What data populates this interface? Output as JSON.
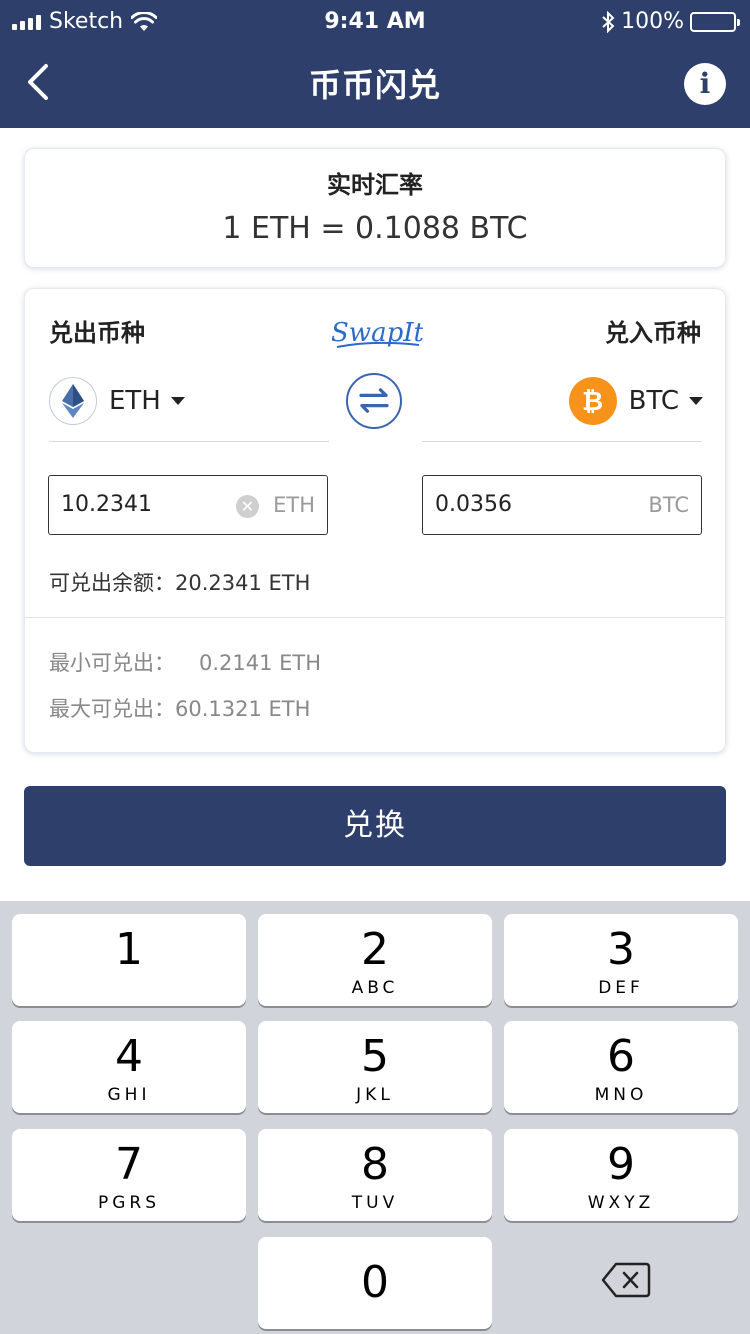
{
  "status_bar": {
    "carrier": "Sketch",
    "time": "9:41 AM",
    "battery": "100%"
  },
  "nav": {
    "title": "币币闪兑",
    "back_icon": "chevron-left-icon",
    "info_icon": "info-icon",
    "info_glyph": "i"
  },
  "rate": {
    "title": "实时汇率",
    "value": "1 ETH = 0.1088 BTC"
  },
  "swap": {
    "out_label": "兑出币种",
    "in_label": "兑入币种",
    "brand": "SwapIt",
    "from_coin": "ETH",
    "to_coin": "BTC",
    "to_coin_glyph": "₿",
    "from_amount": "10.2341",
    "from_unit": "ETH",
    "to_amount": "0.0356",
    "to_unit": "BTC",
    "clear_glyph": "✕",
    "balance": "可兑出余额：20.2341 ETH",
    "min_label": "最小可兑出：",
    "min_value": "0.2141 ETH",
    "max_label": "最大可兑出：",
    "max_value": "60.1321 ETH"
  },
  "exchange_button": "兑换",
  "keypad": {
    "keys": [
      {
        "num": "1",
        "letters": ""
      },
      {
        "num": "2",
        "letters": "ABC"
      },
      {
        "num": "3",
        "letters": "DEF"
      },
      {
        "num": "4",
        "letters": "GHI"
      },
      {
        "num": "5",
        "letters": "JKL"
      },
      {
        "num": "6",
        "letters": "MNO"
      },
      {
        "num": "7",
        "letters": "PGRS"
      },
      {
        "num": "8",
        "letters": "TUV"
      },
      {
        "num": "9",
        "letters": "WXYZ"
      },
      {
        "num": "0",
        "letters": ""
      }
    ],
    "backspace_icon": "backspace-icon"
  },
  "colors": {
    "header": "#2e3f6b",
    "accent": "#3a64b0",
    "btc": "#f7931a"
  }
}
